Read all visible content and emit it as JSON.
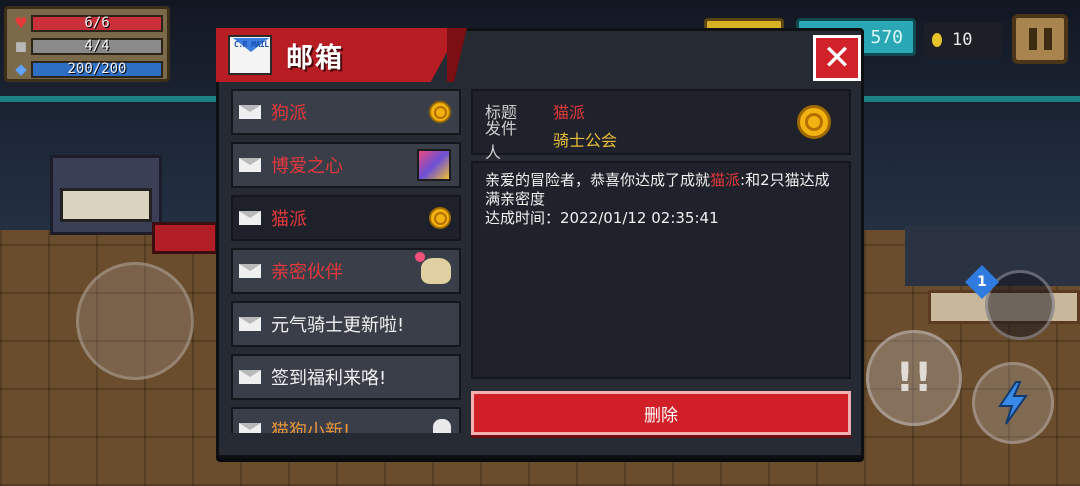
{
  "hud": {
    "hp": "6/6",
    "armor": "4/4",
    "energy": "200/200",
    "gems": "570",
    "coins": "10",
    "weapon_slot_count": "1"
  },
  "mailbox": {
    "title": "邮箱",
    "logo_text": "C.R MAIL",
    "items": [
      {
        "label": "狗派",
        "color": "red",
        "icon": "coin-icon"
      },
      {
        "label": "博爱之心",
        "color": "red",
        "icon": "picture-icon"
      },
      {
        "label": "猫派",
        "color": "red",
        "icon": "coin-icon",
        "selected": true
      },
      {
        "label": "亲密伙伴",
        "color": "red",
        "icon": "pet-icon"
      },
      {
        "label": "元气骑士更新啦!",
        "color": "white",
        "icon": ""
      },
      {
        "label": "签到福利来咯!",
        "color": "white",
        "icon": ""
      },
      {
        "label": "猫狗小新!",
        "color": "orange",
        "icon": "ghost-icon"
      }
    ],
    "detail": {
      "subject_key": "标题",
      "subject_value": "猫派",
      "sender_key": "发件人",
      "sender_value": "骑士公会",
      "body_prefix": "亲爱的冒险者，恭喜你达成了成就",
      "body_highlight": "猫派",
      "body_suffix": ":和2只猫达成满亲密度",
      "time_label": "达成时间：",
      "time_value": "2022/01/12 02:35:41"
    },
    "delete_label": "删除"
  },
  "icons": {
    "close": "close-icon",
    "pause": "pause-icon",
    "heart": "heart-icon",
    "shield": "shield-icon",
    "energy": "energy-icon",
    "skill": "skill-icon",
    "bolt": "bolt-icon"
  },
  "colors": {
    "accent_red": "#d11f27",
    "highlight_red": "#e3383c",
    "gold": "#e8bd3a",
    "panel_bg": "#262a33"
  }
}
